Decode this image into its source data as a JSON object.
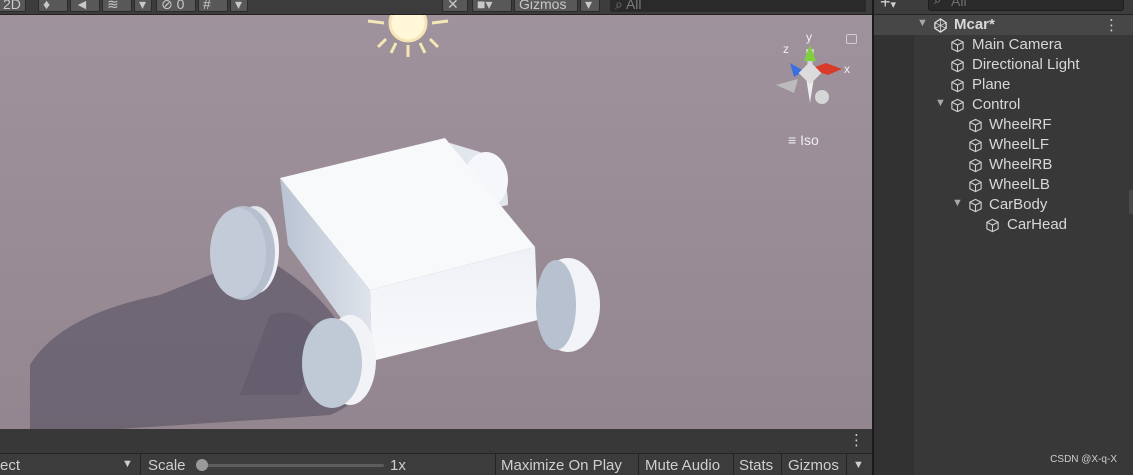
{
  "scene_toolbar": {
    "mode_2d": "2D",
    "hidden_count": "0",
    "gizmos_label": "Gizmos",
    "search_placeholder": "All"
  },
  "scene_view": {
    "projection_label": "Iso",
    "axis_x": "x",
    "axis_y": "y",
    "axis_z": "z"
  },
  "game_toolbar": {
    "aspect_partial": "ect",
    "scale_label": "Scale",
    "scale_value": "1x",
    "maximize_label": "Maximize On Play",
    "mute_label": "Mute Audio",
    "stats_label": "Stats",
    "gizmos_label": "Gizmos"
  },
  "hierarchy": {
    "search_placeholder": "All",
    "scene_name": "Mcar*",
    "items": [
      {
        "label": "Main Camera"
      },
      {
        "label": "Directional Light"
      },
      {
        "label": "Plane"
      },
      {
        "label": "Control"
      },
      {
        "label": "WheelRF"
      },
      {
        "label": "WheelLF"
      },
      {
        "label": "WheelRB"
      },
      {
        "label": "WheelLB"
      },
      {
        "label": "CarBody"
      },
      {
        "label": "CarHead"
      }
    ]
  },
  "watermark": "CSDN @X-q-X",
  "colors": {
    "sky": "#9b8f99",
    "panel": "#383838",
    "gizmo_x": "#d93b2b",
    "gizmo_y": "#7fd13b",
    "gizmo_z": "#3b6fe0"
  }
}
